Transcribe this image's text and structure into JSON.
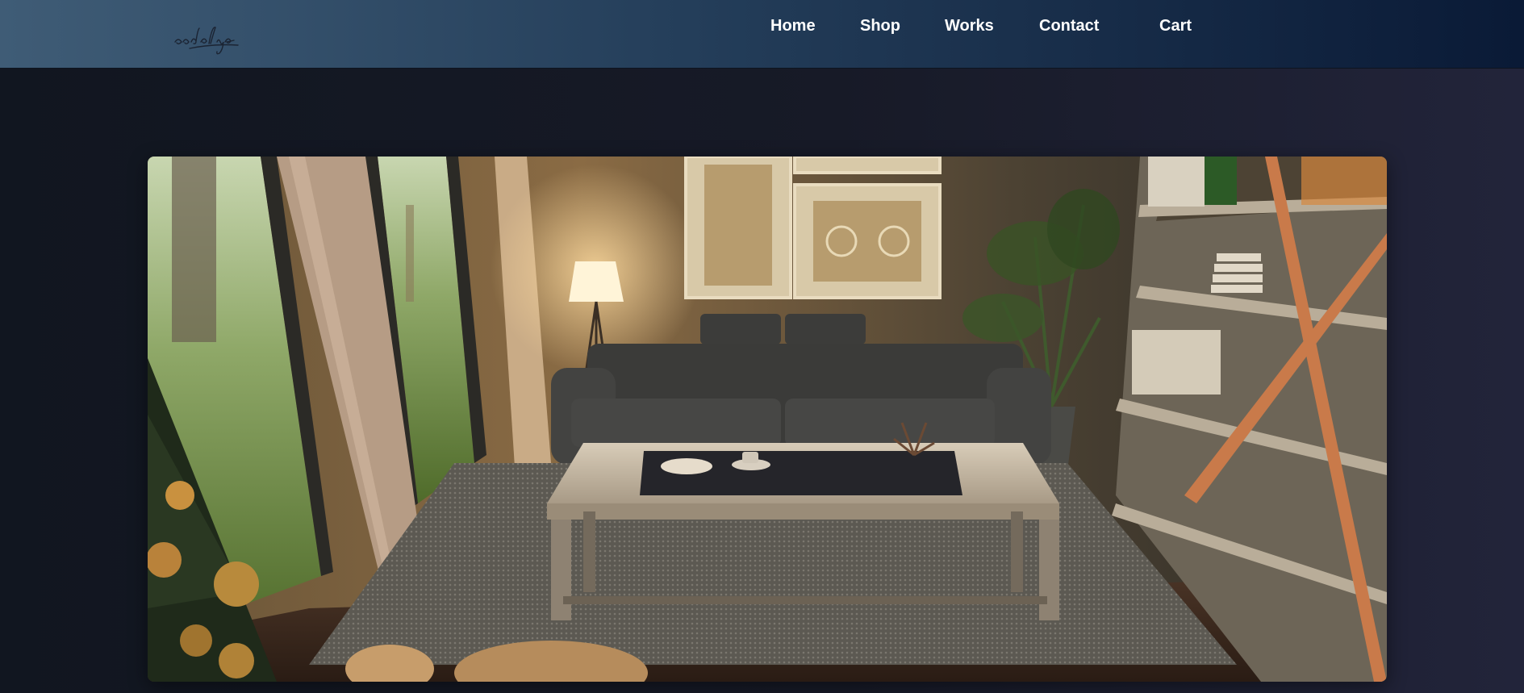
{
  "brand": {
    "logo_text": "audalya"
  },
  "nav": {
    "items": [
      {
        "label": "Home"
      },
      {
        "label": "Shop"
      },
      {
        "label": "Works"
      },
      {
        "label": "Contact"
      },
      {
        "label": "Cart"
      }
    ]
  },
  "hero": {
    "image_subject": "living-room-interior"
  },
  "colors": {
    "nav_start": "#3f5c76",
    "nav_end": "#0a1a36",
    "page_bg": "#151824",
    "nav_text": "#ffffff"
  }
}
